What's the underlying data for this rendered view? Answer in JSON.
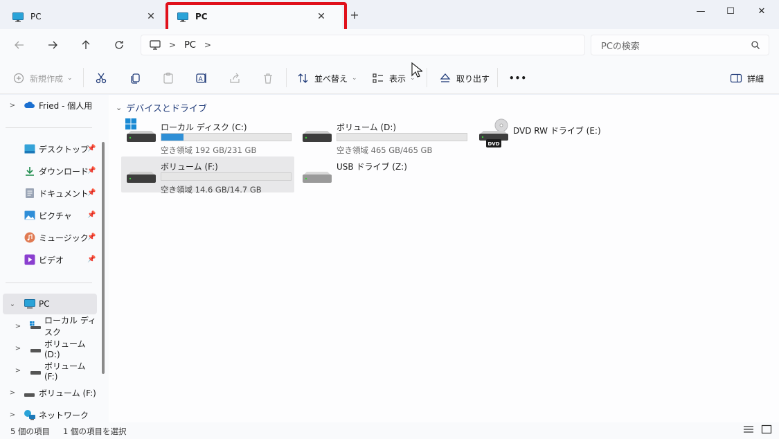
{
  "tabs": [
    {
      "label": "PC",
      "active": false
    },
    {
      "label": "PC",
      "active": true
    }
  ],
  "window_controls": {
    "minimize": "—",
    "maximize": "☐",
    "close": "✕"
  },
  "address": {
    "segment": "PC"
  },
  "search": {
    "placeholder": "PCの検索"
  },
  "commands": {
    "new": "新規作成",
    "sort": "並べ替え",
    "view": "表示",
    "eject": "取り出す",
    "more": "•••",
    "details": "詳細"
  },
  "sidebar": {
    "onedrive": "Fried - 個人用",
    "quick": [
      {
        "label": "デスクトップ",
        "icon": "desktop-icon"
      },
      {
        "label": "ダウンロード",
        "icon": "download-icon"
      },
      {
        "label": "ドキュメント",
        "icon": "document-icon"
      },
      {
        "label": "ピクチャ",
        "icon": "pictures-icon"
      },
      {
        "label": "ミュージック",
        "icon": "music-icon"
      },
      {
        "label": "ビデオ",
        "icon": "video-icon"
      }
    ],
    "pc": "PC",
    "pc_children": [
      {
        "label": "ローカル ディスク"
      },
      {
        "label": "ボリューム (D:)"
      },
      {
        "label": "ボリューム (F:)"
      }
    ],
    "volume_f": "ボリューム (F:)",
    "network": "ネットワーク"
  },
  "content": {
    "group_title": "デバイスとドライブ",
    "drives": [
      {
        "name": "ローカル ディスク (C:)",
        "free": "空き領域 192 GB/231 GB",
        "used_fraction": 0.17,
        "selected": false
      },
      {
        "name": "ボリューム (D:)",
        "free": "空き領域 465 GB/465 GB",
        "used_fraction": 0.0,
        "selected": false
      },
      {
        "name": "DVD RW ドライブ (E:)",
        "dvd_label": "DVD"
      },
      {
        "name": "ボリューム (F:)",
        "free": "空き領域 14.6 GB/14.7 GB",
        "used_fraction": 0.0,
        "selected": true
      },
      {
        "name": "USB ドライブ (Z:)"
      }
    ]
  },
  "status": {
    "items": "5 個の項目",
    "selected": "1 個の項目を選択"
  },
  "colors": {
    "accent": "#2e8fd6",
    "highlight": "#e0101b"
  }
}
